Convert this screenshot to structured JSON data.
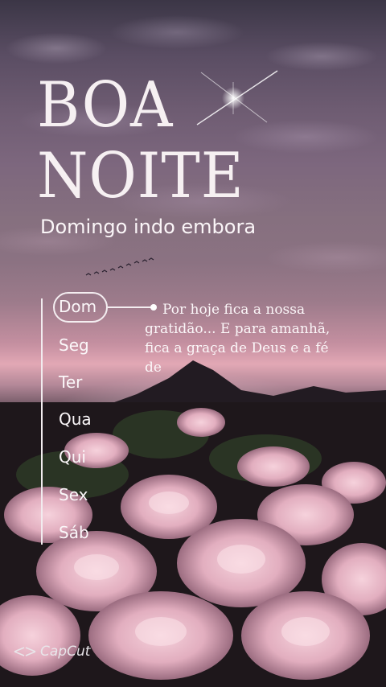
{
  "title": {
    "line1": "BOA",
    "line2": "NOITE"
  },
  "subtitle": "Domingo indo embora",
  "days": [
    {
      "label": "Dom",
      "active": true
    },
    {
      "label": "Seg",
      "active": false
    },
    {
      "label": "Ter",
      "active": false
    },
    {
      "label": "Qua",
      "active": false
    },
    {
      "label": "Qui",
      "active": false
    },
    {
      "label": "Sex",
      "active": false
    },
    {
      "label": "Sáb",
      "active": false
    }
  ],
  "message": "Por hoje fica a nossa gratidão... E para amanhã, fica a graça de Deus e a fé de",
  "watermark": {
    "text": "CapCut",
    "icon": "capcut-logo-icon"
  },
  "colors": {
    "text": "#f6f0f2",
    "sky_glow": "#e2a8b5",
    "flowers": "#e8b8c8"
  }
}
